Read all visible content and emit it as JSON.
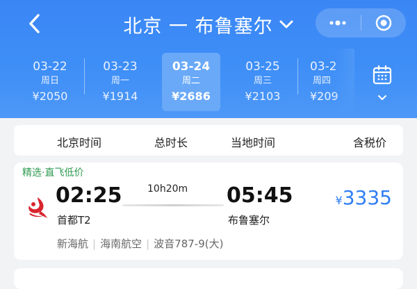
{
  "header": {
    "title": "北京 一 布鲁塞尔",
    "colors": {
      "header_bg": "#3f8ff7",
      "active_tab_bg": "#6aa9f8",
      "price_blue": "#2f7ef5",
      "tag_green": "#2e9a50"
    }
  },
  "dates": [
    {
      "date": "03-22",
      "weekday": "周日",
      "price": "¥2050"
    },
    {
      "date": "03-23",
      "weekday": "周一",
      "price": "¥1914"
    },
    {
      "date": "03-24",
      "weekday": "周二",
      "price": "¥2686",
      "active": true
    },
    {
      "date": "03-25",
      "weekday": "周三",
      "price": "¥2103"
    },
    {
      "date": "03-2",
      "weekday": "周四",
      "price": "¥209"
    }
  ],
  "columns": {
    "departure": "北京时间",
    "duration": "总时长",
    "arrival": "当地时间",
    "price": "含税价"
  },
  "flight": {
    "tag": "精选·直飞低价",
    "dep_time": "02:25",
    "dep_airport": "首都T2",
    "duration": "10h20m",
    "arr_time": "05:45",
    "arr_airport": "布鲁塞尔",
    "currency": "¥",
    "price": "3335",
    "meta": [
      "新海航",
      "海南航空",
      "波音787-9(大)"
    ]
  },
  "icons": [
    "back-icon",
    "chevron-down-icon",
    "more-icon",
    "close-target-icon",
    "calendar-icon",
    "airline-logo-icon"
  ]
}
